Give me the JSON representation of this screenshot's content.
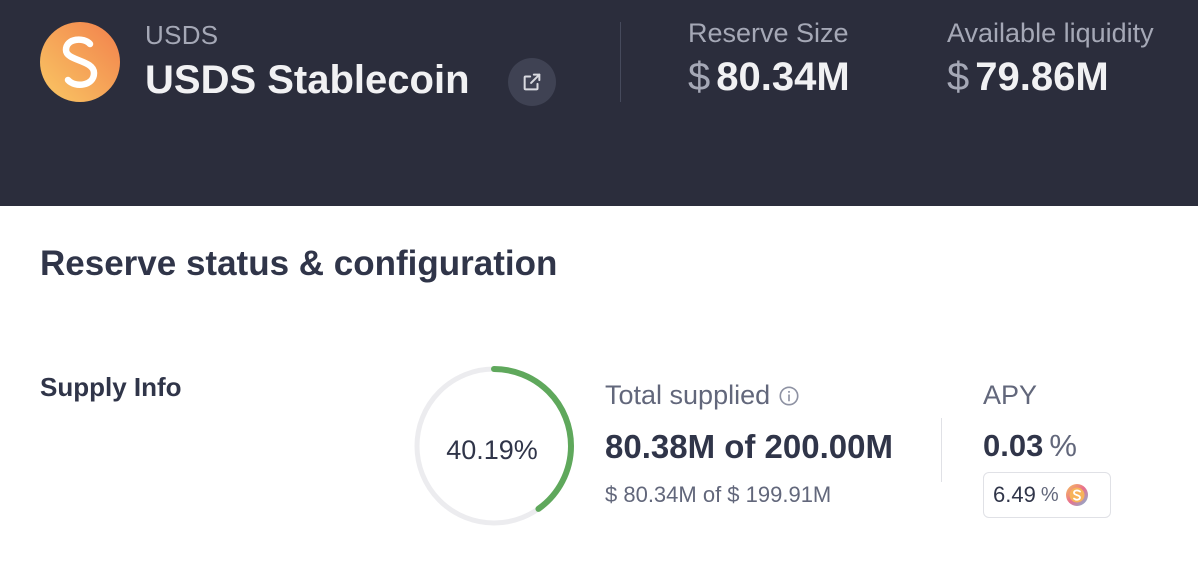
{
  "header": {
    "token_symbol": "USDS",
    "token_name": "USDS Stablecoin",
    "icons": {
      "token_logo": "usds-logo-icon",
      "external_link": "external-link-icon"
    },
    "stats": {
      "reserve_size": {
        "label": "Reserve Size",
        "currency": "$",
        "value": "80.34M"
      },
      "available_liquidity": {
        "label": "Available liquidity",
        "currency": "$",
        "value": "79.86M"
      }
    }
  },
  "main": {
    "section_title": "Reserve status & configuration",
    "supply_info": {
      "label": "Supply Info",
      "utilization_text": "40.19%",
      "utilization_fraction": 0.4019,
      "total_supplied_label": "Total supplied",
      "total_supplied_value": "80.38M of 200.00M",
      "total_supplied_usd": "$ 80.34M of $ 199.91M",
      "apy_label": "APY",
      "apy_value": "0.03",
      "apy_unit": "%",
      "incentive_value": "6.49",
      "incentive_unit": "%"
    }
  },
  "colors": {
    "header_bg": "#2b2d3c",
    "ring_progress": "#5fa85c",
    "ring_track": "#ececef",
    "logo_gradient_start": "#f6c35a",
    "logo_gradient_end": "#f2854e"
  }
}
